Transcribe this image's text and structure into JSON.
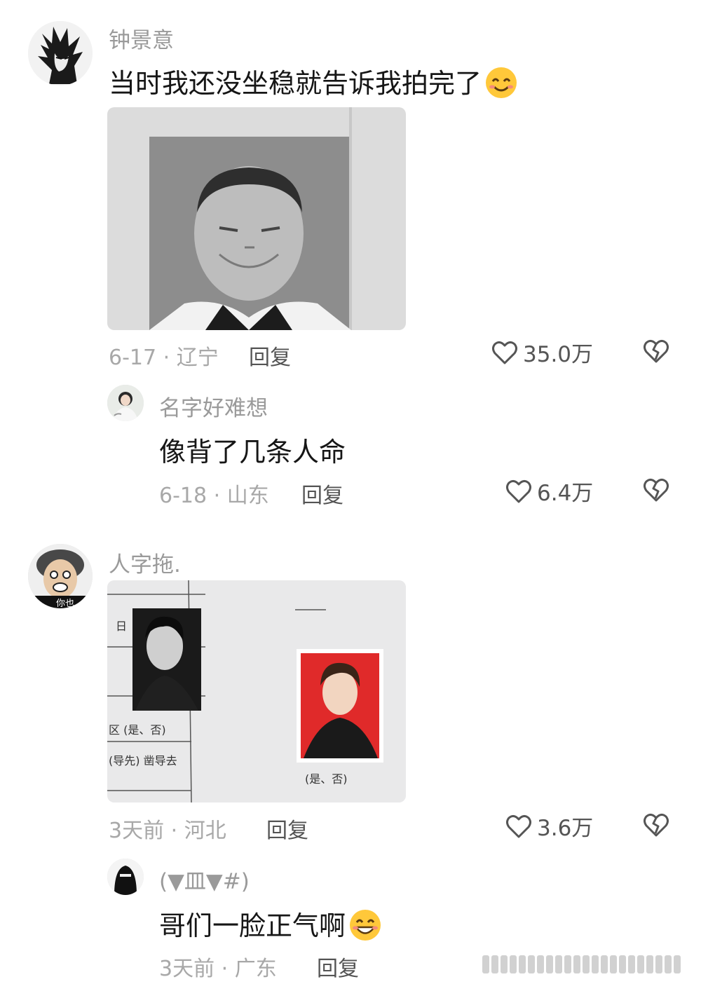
{
  "comments": [
    {
      "username": "钟景意",
      "text": "当时我还没坐稳就告诉我拍完了",
      "emoji": "smile-emoji",
      "meta": "6-17 · 辽宁",
      "reply_label": "回复",
      "likes": "35.0万"
    },
    {
      "username": "名字好难想",
      "text": "像背了几条人命",
      "meta": "6-18 · 山东",
      "reply_label": "回复",
      "likes": "6.4万"
    },
    {
      "username": "人字拖.",
      "meta": "3天前 · 河北",
      "reply_label": "回复",
      "likes": "3.6万",
      "avatar_text": "你也",
      "photo_texts": {
        "left_labels": [
          "日",
          "区 (是、否)",
          "(导先) 凿导去"
        ],
        "right_label": "(是、否)"
      }
    },
    {
      "username": "(▼皿▼#)",
      "text": "哥们一脸正气啊",
      "emoji": "grin-emoji",
      "meta": "3天前 · 广东",
      "reply_label": "回复"
    }
  ],
  "colors": {
    "username": "#9a9a9a",
    "text": "#161616",
    "meta": "#a8a8a8",
    "id_photo_red": "#e02a2a"
  }
}
